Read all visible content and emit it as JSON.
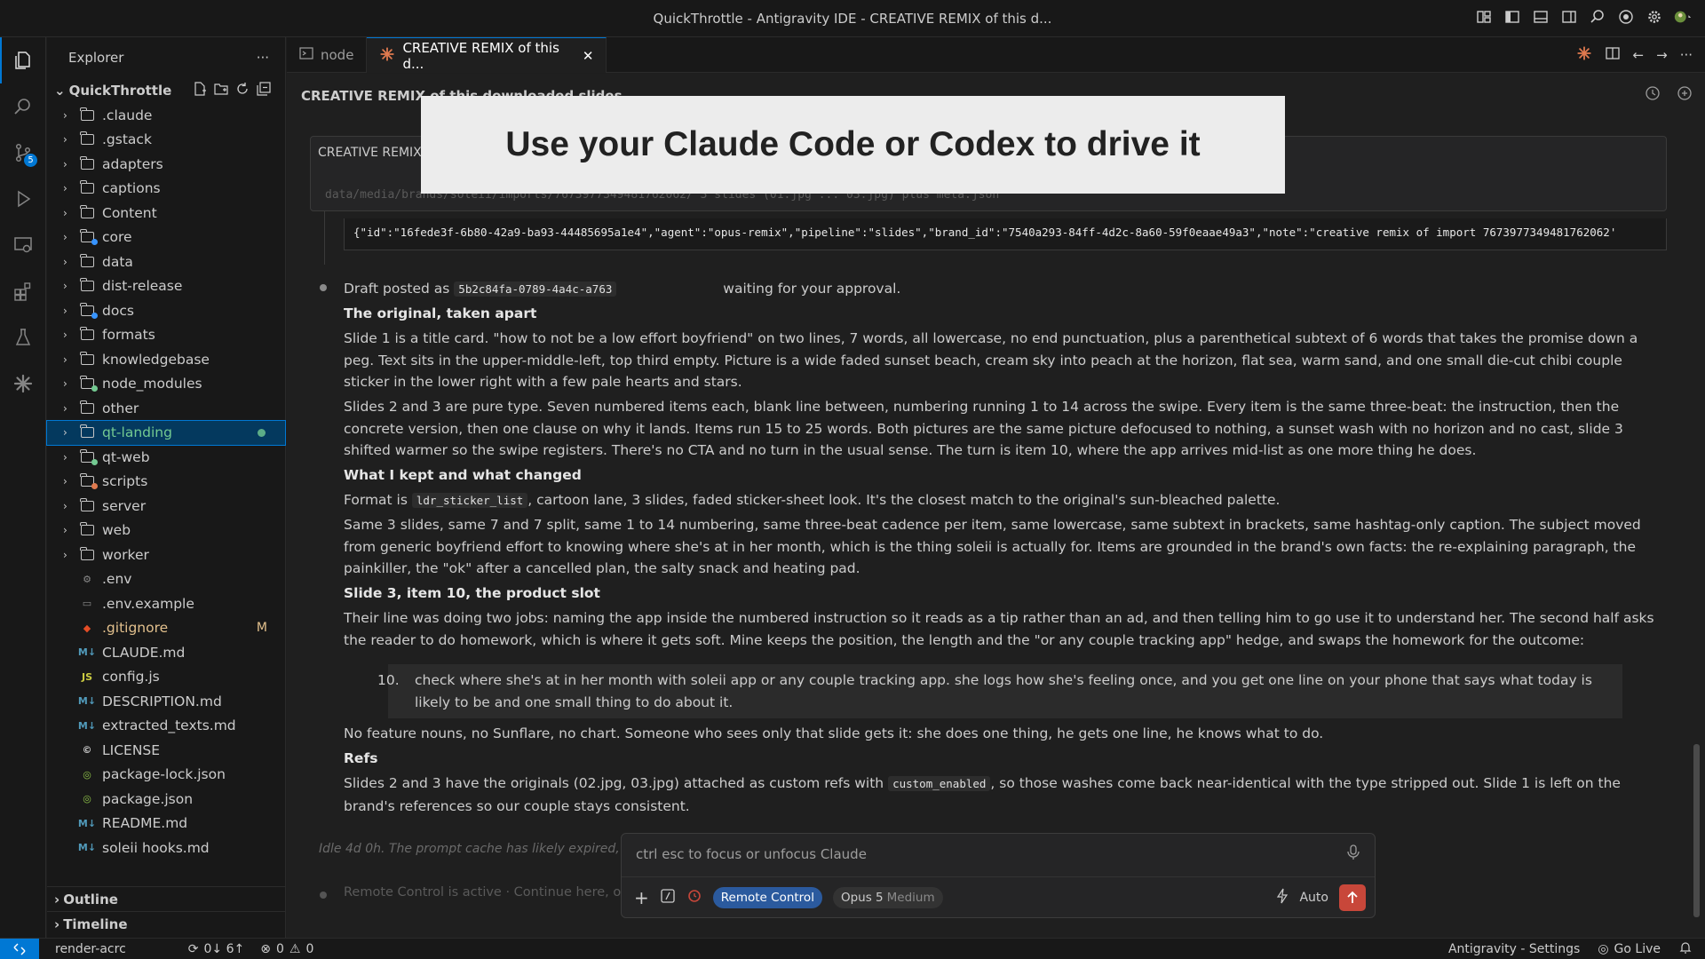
{
  "window": {
    "title": "QuickThrottle - Antigravity IDE - CREATIVE REMIX of this d..."
  },
  "activity_bar": {
    "source_control_badge": "5"
  },
  "sidebar": {
    "title": "Explorer",
    "more": "···",
    "root": "QuickThrottle",
    "folders": [
      {
        "name": ".claude"
      },
      {
        "name": ".gstack"
      },
      {
        "name": "adapters"
      },
      {
        "name": "captions"
      },
      {
        "name": "Content"
      },
      {
        "name": "core"
      },
      {
        "name": "data"
      },
      {
        "name": "dist-release"
      },
      {
        "name": "docs"
      },
      {
        "name": "formats"
      },
      {
        "name": "knowledgebase"
      },
      {
        "name": "node_modules"
      },
      {
        "name": "other"
      },
      {
        "name": "qt-landing"
      },
      {
        "name": "qt-web"
      },
      {
        "name": "scripts"
      },
      {
        "name": "server"
      },
      {
        "name": "web"
      },
      {
        "name": "worker"
      }
    ],
    "files": [
      {
        "name": ".env",
        "icon": "⚙"
      },
      {
        "name": ".env.example",
        "icon": "▭"
      },
      {
        "name": ".gitignore",
        "icon": "◆",
        "status": "M"
      },
      {
        "name": "CLAUDE.md",
        "icon": "M↓"
      },
      {
        "name": "config.js",
        "icon": "JS"
      },
      {
        "name": "DESCRIPTION.md",
        "icon": "M↓"
      },
      {
        "name": "extracted_texts.md",
        "icon": "M↓"
      },
      {
        "name": "LICENSE",
        "icon": "©"
      },
      {
        "name": "package-lock.json",
        "icon": "◎"
      },
      {
        "name": "package.json",
        "icon": "◎"
      },
      {
        "name": "README.md",
        "icon": "M↓"
      },
      {
        "name": "soleii hooks.md",
        "icon": "M↓"
      }
    ],
    "outline": "Outline",
    "timeline": "Timeline"
  },
  "tabs": [
    {
      "label": "node"
    },
    {
      "label": "CREATIVE REMIX of this d..."
    }
  ],
  "main": {
    "doc_title": "CREATIVE REMIX of this downloaded slides",
    "tool_label": "CREATIVE REMIX",
    "tool_path": "data/media/brands/soleii/imports/7673977349481762062/  3 slides (01.jpg ... 03.jpg) plus meta.json",
    "json_line": "{\"id\":\"16fede3f-6b80-42a9-ba93-44485695a1e4\",\"agent\":\"opus-remix\",\"pipeline\":\"slides\",\"brand_id\":\"7540a293-84ff-4d2c-8a60-59f0eaae49a3\",\"note\":\"creative remix of import 7673977349481762062'",
    "draft_prefix": "Draft posted as",
    "draft_id": "5b2c84fa-0789-4a4c-a763",
    "draft_suffix": "waiting for your approval.",
    "h1": "The original, taken apart",
    "p1": "Slide 1 is a title card. \"how to not be a low effort boyfriend\" on two lines, 7 words, all lowercase, no end punctuation, plus a parenthetical subtext of 6 words that takes the promise down a peg. Text sits in the upper-middle-left, top third empty. Picture is a wide faded sunset beach, cream sky into peach at the horizon, flat sea, warm sand, and one small die-cut chibi couple sticker in the lower right with a few pale hearts and stars.",
    "p2": "Slides 2 and 3 are pure type. Seven numbered items each, blank line between, numbering running 1 to 14 across the swipe. Every item is the same three-beat: the instruction, then the concrete version, then one clause on why it lands. Items run 15 to 25 words. Both pictures are the same picture defocused to nothing, a sunset wash with no horizon and no cast, slide 3 shifted warmer so the swipe registers. There's no CTA and no turn in the usual sense. The turn is item 10, where the app arrives mid-list as one more thing he does.",
    "h2": "What I kept and what changed",
    "p3_prefix": "Format is",
    "p3_code": "ldr_sticker_list",
    "p3_suffix": ", cartoon lane, 3 slides, faded sticker-sheet look. It's the closest match to the original's sun-bleached palette.",
    "p4": "Same 3 slides, same 7 and 7 split, same 1 to 14 numbering, same three-beat cadence per item, same lowercase, same subtext in brackets, same hashtag-only caption. The subject moved from generic boyfriend effort to knowing where she's at in her month, which is the thing soleii is actually for. Items are grounded in the brand's own facts: the re-explaining paragraph, the painkiller, the \"ok\" after a cancelled plan, the salty snack and heating pad.",
    "h3": "Slide 3, item 10, the product slot",
    "p5": "Their line was doing two jobs: naming the app inside the numbered instruction so it reads as a tip rather than an ad, and then telling him to go use it to understand her. The second half asks the reader to do homework, which is where it gets soft. Mine keeps the position, the length and the \"or any couple tracking app\" hedge, and swaps the homework for the outcome:",
    "quote_num": "10.",
    "quote": "check where she's at in her month with soleii app or any couple tracking app. she logs how she's feeling once, and you get one line on your phone that says what today is likely to be and one small thing to do about it.",
    "p6": "No feature nouns, no Sunflare, no chart. Someone who sees only that slide gets it: she does one thing, he gets one line, he knows what to do.",
    "h4": "Refs",
    "p7_prefix": "Slides 2 and 3 have the originals (02.jpg, 03.jpg) attached as custom refs with",
    "p7_code": "custom_enabled",
    "p7_suffix": ", so those washes come back near-identical with the type stripped out. Slide 1 is left on the brand's references so our couple stays consistent.",
    "idle": "Idle 4d 0h. The prompt cache has likely expired, s",
    "remote": "Remote Control is active · Continue here, or"
  },
  "overlay": {
    "text": "Use your Claude Code or Codex to drive it"
  },
  "prompt": {
    "placeholder": "ctrl esc to focus or unfocus Claude",
    "remote_pill": "Remote Control",
    "model": "Opus 5",
    "effort": "Medium",
    "mode": "Auto"
  },
  "status": {
    "branch": "render-acrc",
    "sync": "0↓ 6↑",
    "errors": "0",
    "warnings": "0",
    "settings": "Antigravity - Settings",
    "golive": "Go Live"
  }
}
